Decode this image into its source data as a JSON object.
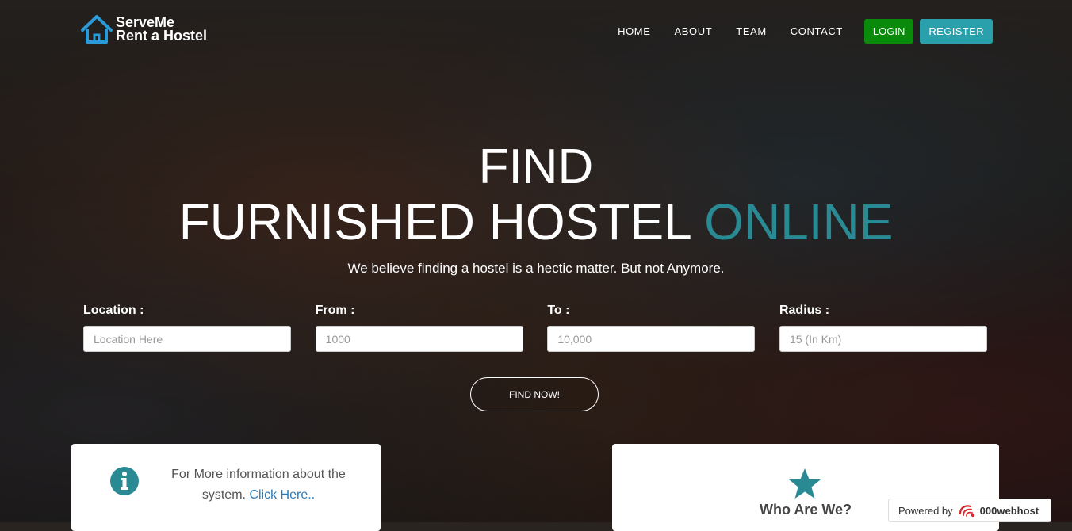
{
  "brand": {
    "line1": "ServeMe",
    "line2": "Rent a Hostel",
    "icon": "house-icon"
  },
  "nav": {
    "items": [
      {
        "label": "HOME"
      },
      {
        "label": "ABOUT"
      },
      {
        "label": "TEAM"
      },
      {
        "label": "CONTACT"
      }
    ],
    "login": "LOGIN",
    "register": "REGISTER"
  },
  "hero": {
    "line1": "FIND",
    "line2_main": "FURNISHED HOSTEL",
    "line2_accent": "ONLINE",
    "tagline": "We believe finding a hostel is a hectic matter. But not Anymore."
  },
  "search": {
    "location": {
      "label": "Location :",
      "placeholder": "Location Here"
    },
    "from": {
      "label": "From :",
      "placeholder": "1000"
    },
    "to": {
      "label": "To :",
      "placeholder": "10,000"
    },
    "radius": {
      "label": "Radius :",
      "placeholder": "15 (In Km)"
    },
    "submit": "FIND NOW!"
  },
  "cards": {
    "info": {
      "icon": "info-circle-icon",
      "text": "For More information about the system.",
      "link": "Click Here.."
    },
    "who": {
      "icon": "star-icon",
      "title": "Who Are We?"
    }
  },
  "footer_badge": {
    "prefix": "Powered by",
    "brand": "000webhost",
    "icon": "000webhost-logo-icon"
  },
  "colors": {
    "accent": "#2a8a94",
    "login": "#0a8a0a",
    "register": "#2aa0ad",
    "link": "#2a7ab8"
  }
}
